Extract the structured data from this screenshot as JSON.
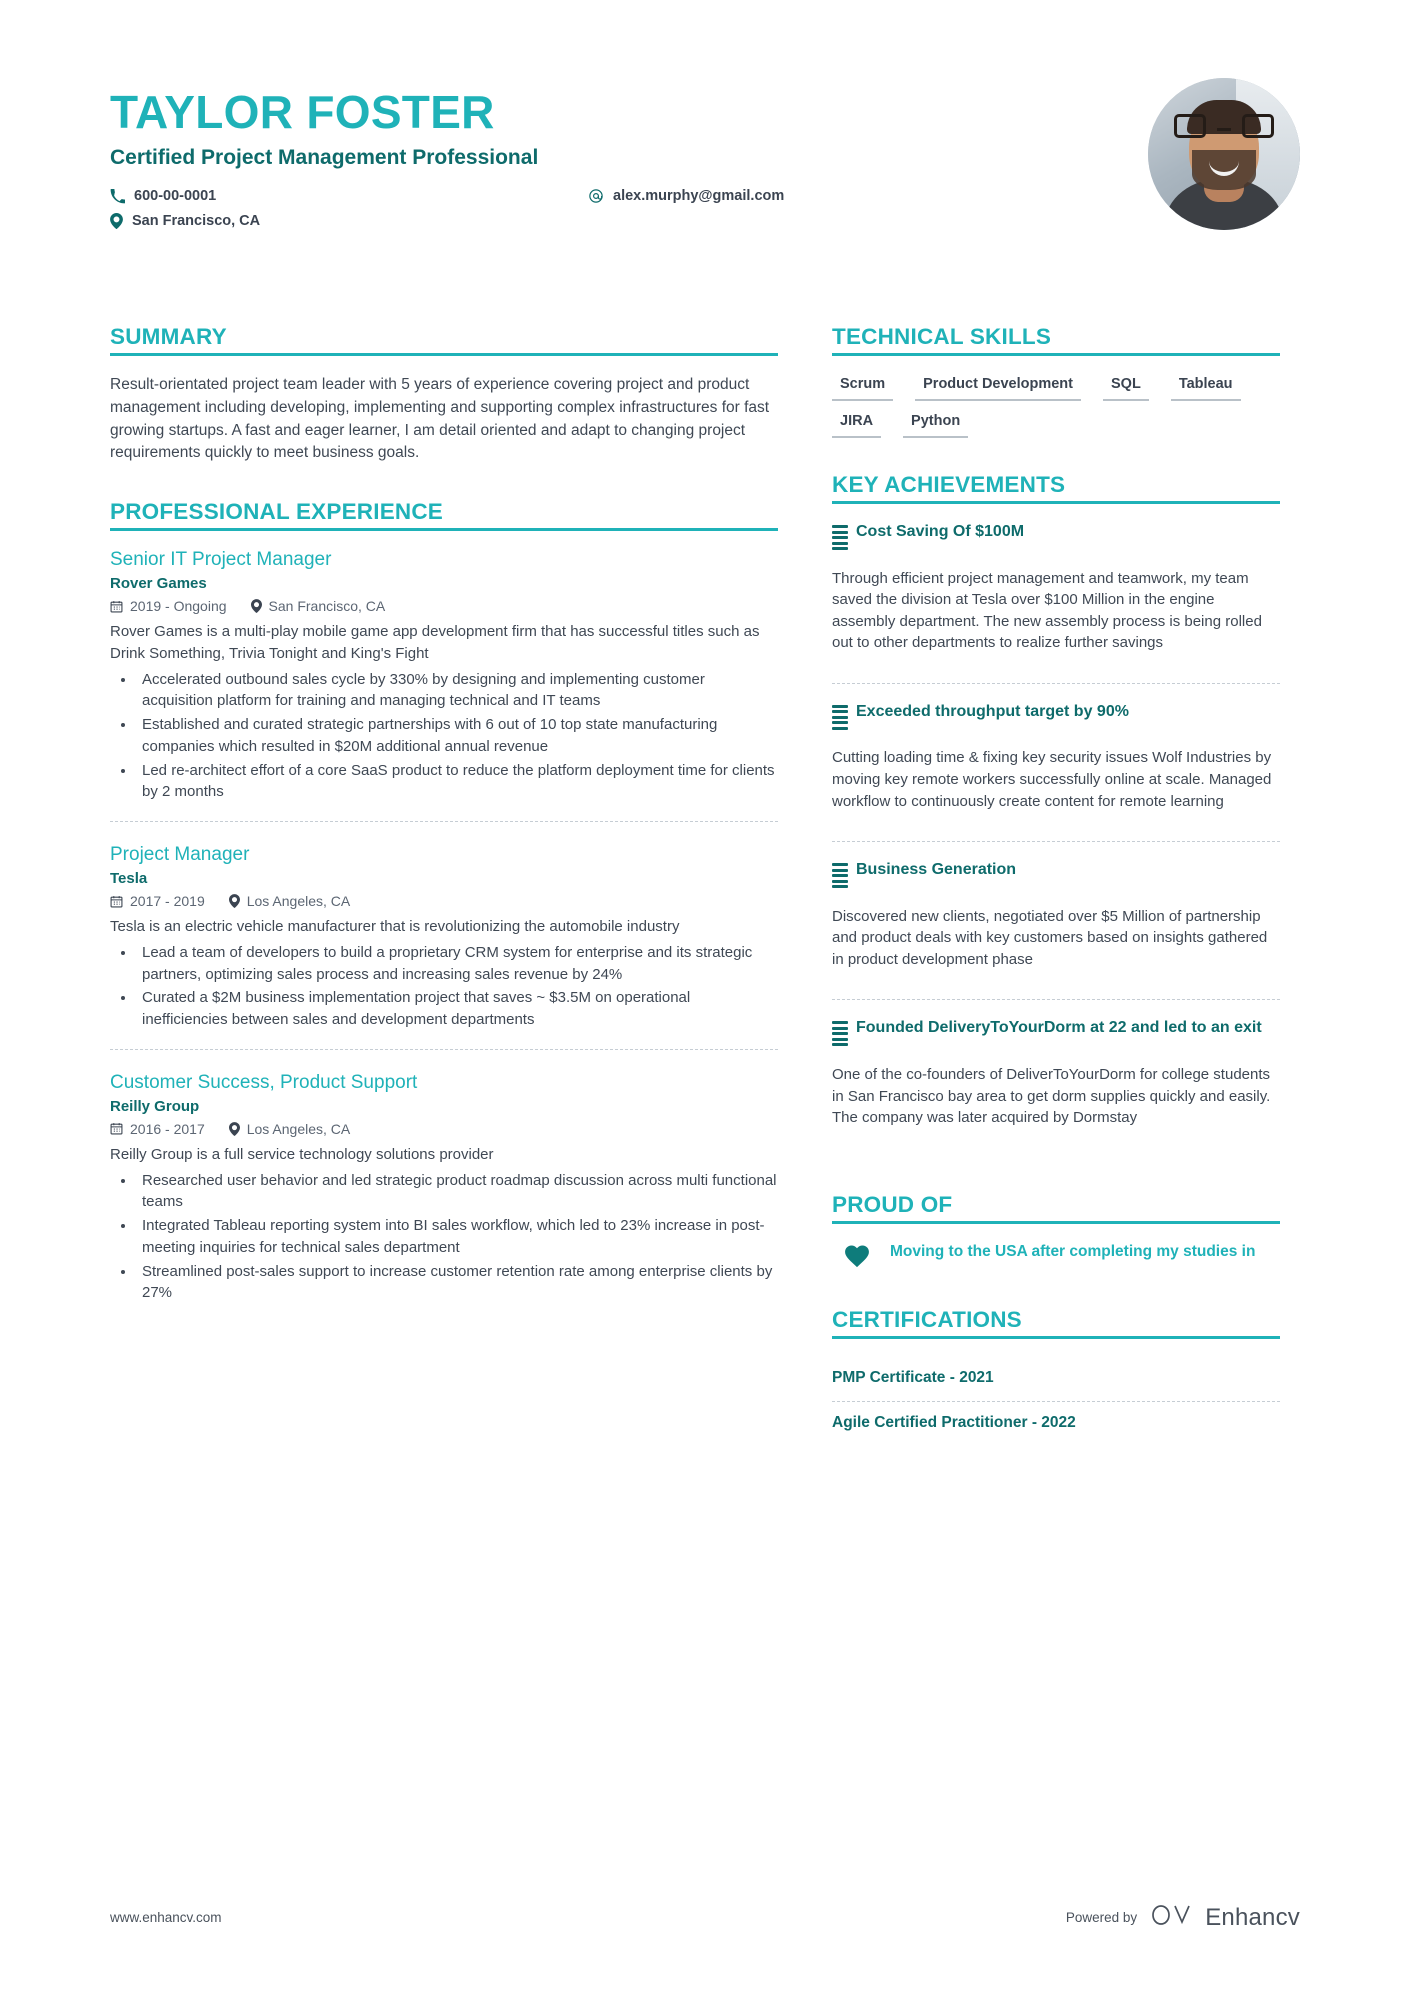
{
  "header": {
    "name": "TAYLOR FOSTER",
    "job_title": "Certified Project Management Professional",
    "phone": "600-00-0001",
    "email": "alex.murphy@gmail.com",
    "location": "San Francisco, CA",
    "accent_color": "#1fb2b8",
    "dark_accent_color": "#0e6b6b"
  },
  "summary": {
    "title": "SUMMARY",
    "text": "Result-orientated project team leader with 5 years of experience covering project and product management including developing, implementing and supporting complex infrastructures for fast growing startups. A fast and eager learner, I am detail oriented and adapt to changing project requirements quickly to meet business goals."
  },
  "experience": {
    "title": "PROFESSIONAL EXPERIENCE",
    "jobs": [
      {
        "role": "Senior IT Project Manager",
        "company": "Rover Games",
        "dates": "2019 - Ongoing",
        "location": "San Francisco, CA",
        "description": "Rover Games is a multi-play mobile game app development firm that has successful titles such as Drink Something, Trivia Tonight and King's Fight",
        "bullets": [
          "Accelerated outbound sales cycle by 330% by designing and implementing customer acquisition platform for training and managing technical and IT teams",
          "Established and curated strategic partnerships with 6 out of 10 top state manufacturing companies which resulted in $20M additional annual revenue",
          "Led re-architect effort of a core SaaS product to reduce the platform deployment time for clients by 2 months"
        ]
      },
      {
        "role": "Project Manager",
        "company": "Tesla",
        "dates": "2017 - 2019",
        "location": "Los Angeles, CA",
        "description": "Tesla is an electric vehicle manufacturer that is revolutionizing the automobile industry",
        "bullets": [
          "Lead a team of developers to build a proprietary CRM system for enterprise and its strategic partners, optimizing sales process and increasing sales revenue by 24%",
          "Curated a $2M business implementation project that saves ~ $3.5M on operational inefficiencies between sales and development departments"
        ]
      },
      {
        "role": "Customer Success, Product Support",
        "company": "Reilly Group",
        "dates": "2016 - 2017",
        "location": "Los Angeles, CA",
        "description": "Reilly Group is a full service technology solutions provider",
        "bullets": [
          "Researched user behavior and led strategic product roadmap discussion across multi functional teams",
          "Integrated Tableau reporting system into BI sales workflow, which led to 23% increase in post-meeting inquiries for technical sales department",
          "Streamlined post-sales support to increase customer retention rate among enterprise clients by 27%"
        ]
      }
    ]
  },
  "technical_skills": {
    "title": "TECHNICAL SKILLS",
    "items": [
      "Scrum",
      "Product Development",
      "SQL",
      "Tableau",
      "JIRA",
      "Python"
    ]
  },
  "key_achievements": {
    "title": "KEY ACHIEVEMENTS",
    "items": [
      {
        "title": "Cost Saving Of $100M",
        "text": "Through efficient project management and teamwork, my team saved the division at Tesla over $100 Million in the engine assembly department. The new assembly process is being rolled out to other departments to realize further savings"
      },
      {
        "title": "Exceeded throughput target by 90%",
        "text": "Cutting loading time & fixing key security issues Wolf Industries by moving key remote workers successfully online at scale. Managed workflow to continuously create content for remote learning"
      },
      {
        "title": "Business Generation",
        "text": "Discovered new clients, negotiated over $5 Million of partnership and product deals with key customers based on insights gathered in product development phase"
      },
      {
        "title": "Founded DeliveryToYourDorm at 22 and led to an exit",
        "text": "One of the co-founders of DeliverToYourDorm for college students in San Francisco bay area to get dorm supplies quickly and easily. The company was later acquired by Dormstay"
      }
    ]
  },
  "proud_of": {
    "title": "PROUD OF",
    "items": [
      {
        "text": "Moving to the USA after completing my studies in"
      }
    ]
  },
  "certifications": {
    "title": "CERTIFICATIONS",
    "items": [
      "PMP Certificate - 2021",
      "Agile Certified Practitioner - 2022"
    ]
  },
  "footer": {
    "url": "www.enhancv.com",
    "powered_by": "Powered by",
    "brand": "Enhancv"
  }
}
